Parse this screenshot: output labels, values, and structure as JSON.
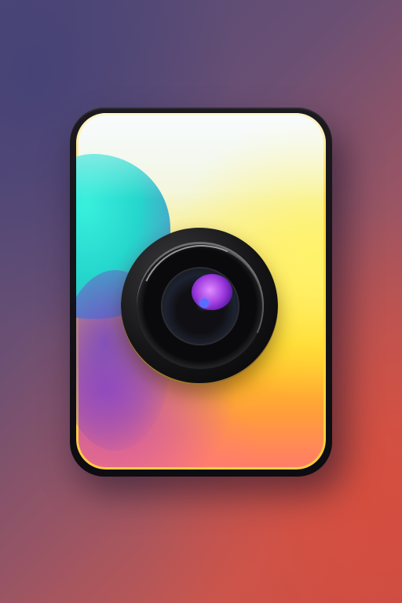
{
  "image": {
    "subject": "camera-app-icon",
    "colors": {
      "background_top_left": "#4e4a78",
      "background_bottom_right": "#c44a45",
      "frame": "#121015",
      "card_rim": "#ffd63c",
      "teal_accent": "#25d6cc",
      "yellow_fill": "#ffe95a",
      "orange_fill": "#ff9c3c",
      "lens_body": "#0a0a0c",
      "lens_glint": "#a23ee0"
    }
  }
}
